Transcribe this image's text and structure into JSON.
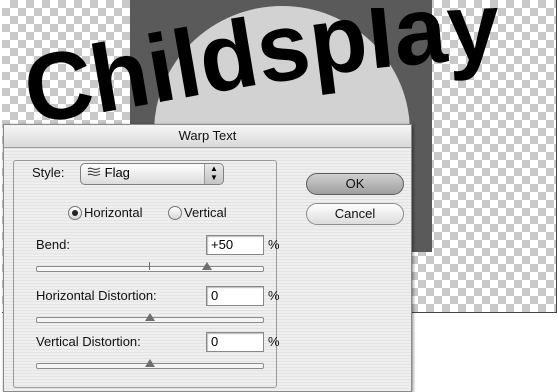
{
  "canvas": {
    "warped_text": "Childsplay"
  },
  "dialog": {
    "title": "Warp Text",
    "style_label": "Style:",
    "style_value": "Flag",
    "style_icon": "flag-warp-icon",
    "orientation": {
      "horizontal": "Horizontal",
      "vertical": "Vertical",
      "selected": "horizontal"
    },
    "bend": {
      "label": "Bend:",
      "value": "+50",
      "unit": "%",
      "slider_level": 0.75
    },
    "h_distortion": {
      "label": "Horizontal Distortion:",
      "value": "0",
      "unit": "%",
      "slider_level": 0.5
    },
    "v_distortion": {
      "label": "Vertical Distortion:",
      "value": "0",
      "unit": "%",
      "slider_level": 0.5
    },
    "ok_label": "OK",
    "cancel_label": "Cancel"
  }
}
